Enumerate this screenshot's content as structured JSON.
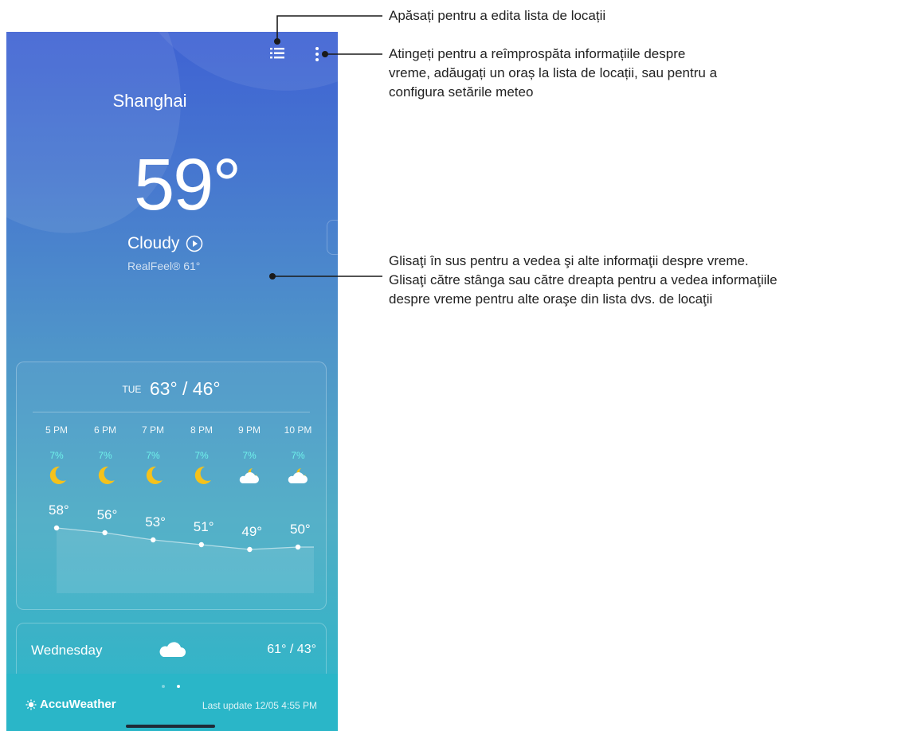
{
  "city": "Shanghai",
  "current": {
    "temperature": "59°",
    "condition": "Cloudy",
    "realfeel": "RealFeel® 61°"
  },
  "today": {
    "day": "TUE",
    "high_low": "63° / 46°"
  },
  "hourly": [
    {
      "time": "5 PM",
      "precip": "7%",
      "icon": "moon-icon",
      "temp": "58°",
      "temp_value": 58
    },
    {
      "time": "6 PM",
      "precip": "7%",
      "icon": "moon-icon",
      "temp": "56°",
      "temp_value": 56
    },
    {
      "time": "7 PM",
      "precip": "7%",
      "icon": "moon-icon",
      "temp": "53°",
      "temp_value": 53
    },
    {
      "time": "8 PM",
      "precip": "7%",
      "icon": "moon-icon",
      "temp": "51°",
      "temp_value": 51
    },
    {
      "time": "9 PM",
      "precip": "7%",
      "icon": "cloudy-night-icon",
      "temp": "49°",
      "temp_value": 49
    },
    {
      "time": "10 PM",
      "precip": "7%",
      "icon": "cloudy-night-icon",
      "temp": "50°",
      "temp_value": 50
    }
  ],
  "daily": {
    "day": "Wednesday",
    "icon": "cloud-icon",
    "high_low": "61° / 43°"
  },
  "footer": {
    "brand": "AccuWeather",
    "last_update": "Last update 12/05 4:55 PM"
  },
  "annotations": {
    "list_note": "Apăsați pentru a edita lista de locații",
    "menu_note_lines": [
      "Atingeți pentru a reîmprospăta informațiile despre",
      "vreme, adăugați un oraș la lista de locații, sau pentru a",
      "configura setările meteo"
    ],
    "swipe_note_lines": [
      "Glisaţi în sus pentru a vedea şi alte informaţii despre vreme.",
      "Glisaţi către stânga sau către dreapta pentru a vedea informaţiile",
      "despre vreme pentru alte oraşe din lista dvs. de locaţii"
    ]
  },
  "colors": {
    "gradient_top": "#3f62d3",
    "gradient_bottom": "#2ab7c8",
    "precip": "#6ff0ea",
    "moon": "#f5c21b"
  }
}
